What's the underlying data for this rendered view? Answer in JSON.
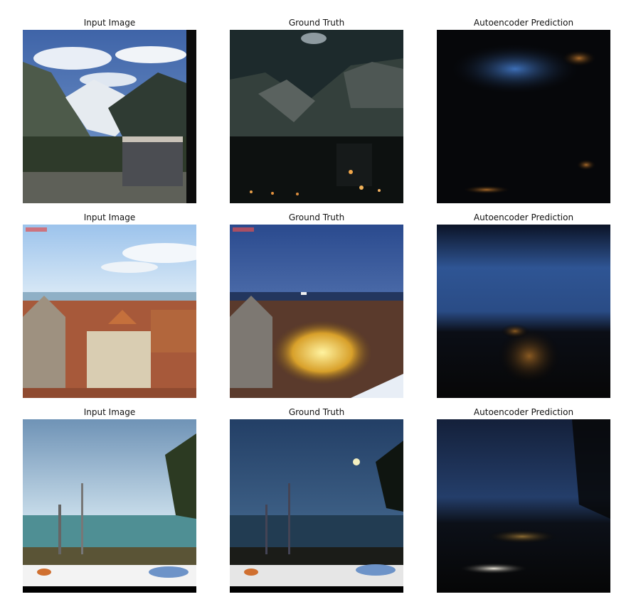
{
  "columns": [
    "Input Image",
    "Ground Truth",
    "Autoencoder Prediction"
  ],
  "rows": [
    {
      "scene": "alpine-valley",
      "titles": [
        "Input Image",
        "Ground Truth",
        "Autoencoder Prediction"
      ]
    },
    {
      "scene": "coastal-old-town",
      "titles": [
        "Input Image",
        "Ground Truth",
        "Autoencoder Prediction"
      ],
      "watermark_label": "Vierwaldstaetter"
    },
    {
      "scene": "lakeside-palm",
      "titles": [
        "Input Image",
        "Ground Truth",
        "Autoencoder Prediction"
      ]
    }
  ]
}
